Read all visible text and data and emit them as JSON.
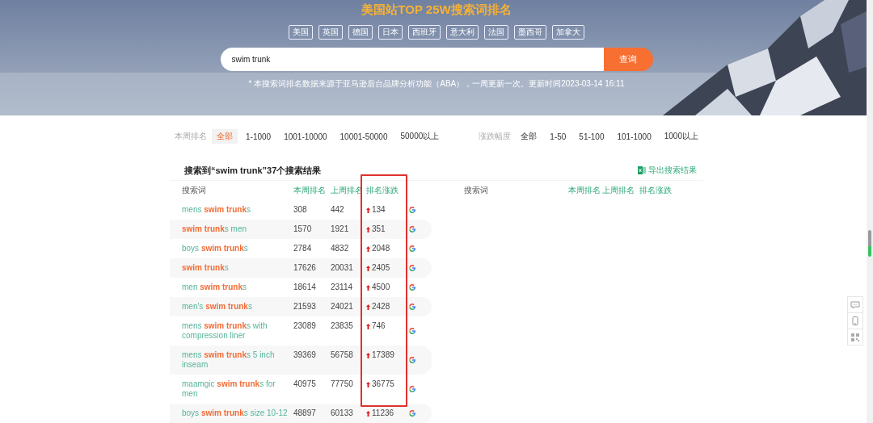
{
  "header": {
    "title": "美国站TOP 25W搜索词排名",
    "countries": [
      {
        "label": "美国"
      },
      {
        "label": "英国"
      },
      {
        "label": "德国"
      },
      {
        "label": "日本"
      },
      {
        "label": "西班牙"
      },
      {
        "label": "意大利"
      },
      {
        "label": "法国"
      },
      {
        "label": "墨西哥"
      },
      {
        "label": "加拿大"
      }
    ],
    "search": {
      "value": "swim trunk",
      "button": "查询"
    },
    "note": "* 本搜索词排名数据来源于亚马逊后台品牌分析功能（ABA），一周更新一次。更新时间2023-03-14 16:11"
  },
  "filters": [
    {
      "label": "本周排名",
      "options": [
        {
          "label": "全部",
          "selected": true
        },
        {
          "label": "1-1000",
          "selected": false
        },
        {
          "label": "1001-10000",
          "selected": false
        },
        {
          "label": "10001-50000",
          "selected": false
        },
        {
          "label": "50000以上",
          "selected": false
        }
      ]
    },
    {
      "label": "涨跌幅度",
      "options": [
        {
          "label": "全部",
          "selected": false
        },
        {
          "label": "1-50",
          "selected": false
        },
        {
          "label": "51-100",
          "selected": false
        },
        {
          "label": "101-1000",
          "selected": false
        },
        {
          "label": "1000以上",
          "selected": false
        }
      ]
    }
  ],
  "results": {
    "summary": "搜索到“swim trunk”37个搜索结果",
    "export": "导出搜索结果",
    "columns": [
      "搜索词",
      "本周排名",
      "上周排名",
      "排名涨跌"
    ],
    "right_columns": [
      "搜索词",
      "本周排名",
      "上周排名",
      "排名涨跌"
    ],
    "rows": [
      {
        "keyword": "mens **swim trunk**s",
        "this_week": "308",
        "last_week": "442",
        "change": "134"
      },
      {
        "keyword": "**swim trunk**s men",
        "this_week": "1570",
        "last_week": "1921",
        "change": "351"
      },
      {
        "keyword": "boys **swim trunk**s",
        "this_week": "2784",
        "last_week": "4832",
        "change": "2048"
      },
      {
        "keyword": "**swim trunk**s",
        "this_week": "17626",
        "last_week": "20031",
        "change": "2405"
      },
      {
        "keyword": "men **swim trunk**s",
        "this_week": "18614",
        "last_week": "23114",
        "change": "4500"
      },
      {
        "keyword": "men's **swim trunk**s",
        "this_week": "21593",
        "last_week": "24021",
        "change": "2428"
      },
      {
        "keyword": "mens **swim trunk**s with compression liner",
        "this_week": "23089",
        "last_week": "23835",
        "change": "746"
      },
      {
        "keyword": "mens **swim trunk**s 5 inch inseam",
        "this_week": "39369",
        "last_week": "56758",
        "change": "17389"
      },
      {
        "keyword": "maamgic **swim trunk**s for men",
        "this_week": "40975",
        "last_week": "77750",
        "change": "36775"
      },
      {
        "keyword": "boys **swim trunk**s size 10-12",
        "this_week": "48897",
        "last_week": "60133",
        "change": "11236"
      }
    ]
  }
}
